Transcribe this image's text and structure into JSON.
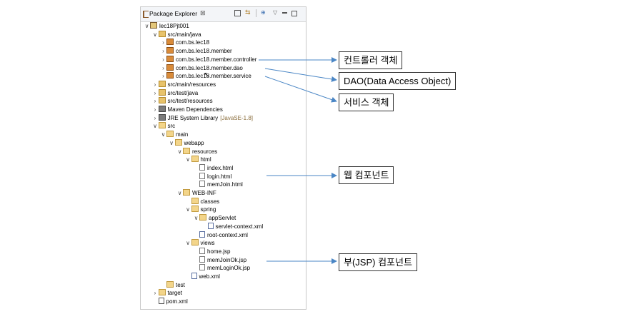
{
  "panel": {
    "title": "Package Explorer",
    "close_glyph": "⊠",
    "toolbar": {
      "link_glyph": "⇆",
      "focus_glyph": "⊕",
      "menu_glyph": "▽"
    }
  },
  "tree": [
    {
      "indent": 0,
      "chevron": "∨",
      "icon": "project",
      "label": "lec18Pjt001",
      "deco": ""
    },
    {
      "indent": 1,
      "chevron": "∨",
      "icon": "srcfolder",
      "label": "src/main/java",
      "deco": ""
    },
    {
      "indent": 2,
      "chevron": "›",
      "icon": "package",
      "label": "com.bs.lec18",
      "deco": ""
    },
    {
      "indent": 2,
      "chevron": "›",
      "icon": "package",
      "label": "com.bs.lec18.member",
      "deco": ""
    },
    {
      "indent": 2,
      "chevron": "›",
      "icon": "package",
      "label": "com.bs.lec18.member.controller",
      "deco": ""
    },
    {
      "indent": 2,
      "chevron": "›",
      "icon": "package",
      "label": "com.bs.lec18.member.dao",
      "deco": ""
    },
    {
      "indent": 2,
      "chevron": "›",
      "icon": "package",
      "label": "com.bs.lec18.member.service",
      "deco": ""
    },
    {
      "indent": 1,
      "chevron": "›",
      "icon": "srcfolder",
      "label": "src/main/resources",
      "deco": ""
    },
    {
      "indent": 1,
      "chevron": "›",
      "icon": "srcfolder",
      "label": "src/test/java",
      "deco": ""
    },
    {
      "indent": 1,
      "chevron": "›",
      "icon": "srcfolder",
      "label": "src/test/resources",
      "deco": ""
    },
    {
      "indent": 1,
      "chevron": "›",
      "icon": "library",
      "label": "Maven Dependencies",
      "deco": ""
    },
    {
      "indent": 1,
      "chevron": "›",
      "icon": "library",
      "label": "JRE System Library",
      "deco": "[JavaSE-1.8]"
    },
    {
      "indent": 1,
      "chevron": "∨",
      "icon": "folder",
      "label": "src",
      "deco": ""
    },
    {
      "indent": 2,
      "chevron": "∨",
      "icon": "folder",
      "label": "main",
      "deco": ""
    },
    {
      "indent": 3,
      "chevron": "∨",
      "icon": "folder",
      "label": "webapp",
      "deco": ""
    },
    {
      "indent": 4,
      "chevron": "∨",
      "icon": "folder",
      "label": "resources",
      "deco": ""
    },
    {
      "indent": 5,
      "chevron": "∨",
      "icon": "folder",
      "label": "html",
      "deco": ""
    },
    {
      "indent": 6,
      "chevron": "",
      "icon": "file",
      "label": "index.html",
      "deco": ""
    },
    {
      "indent": 6,
      "chevron": "",
      "icon": "file",
      "label": "login.html",
      "deco": ""
    },
    {
      "indent": 6,
      "chevron": "",
      "icon": "file",
      "label": "memJoin.html",
      "deco": ""
    },
    {
      "indent": 4,
      "chevron": "∨",
      "icon": "folder",
      "label": "WEB-INF",
      "deco": ""
    },
    {
      "indent": 5,
      "chevron": "",
      "icon": "folder",
      "label": "classes",
      "deco": ""
    },
    {
      "indent": 5,
      "chevron": "∨",
      "icon": "folder",
      "label": "spring",
      "deco": ""
    },
    {
      "indent": 6,
      "chevron": "∨",
      "icon": "folder",
      "label": "appServlet",
      "deco": ""
    },
    {
      "indent": 7,
      "chevron": "",
      "icon": "xml",
      "label": "servlet-context.xml",
      "deco": ""
    },
    {
      "indent": 6,
      "chevron": "",
      "icon": "xml",
      "label": "root-context.xml",
      "deco": ""
    },
    {
      "indent": 5,
      "chevron": "∨",
      "icon": "folder",
      "label": "views",
      "deco": ""
    },
    {
      "indent": 6,
      "chevron": "",
      "icon": "jsp",
      "label": "home.jsp",
      "deco": ""
    },
    {
      "indent": 6,
      "chevron": "",
      "icon": "jsp",
      "label": "memJoinOk.jsp",
      "deco": ""
    },
    {
      "indent": 6,
      "chevron": "",
      "icon": "jsp",
      "label": "memLoginOk.jsp",
      "deco": ""
    },
    {
      "indent": 5,
      "chevron": "",
      "icon": "xml",
      "label": "web.xml",
      "deco": ""
    },
    {
      "indent": 2,
      "chevron": "",
      "icon": "folder",
      "label": "test",
      "deco": ""
    },
    {
      "indent": 1,
      "chevron": "›",
      "icon": "folder",
      "label": "target",
      "deco": ""
    },
    {
      "indent": 1,
      "chevron": "",
      "icon": "pom",
      "label": "pom.xml",
      "deco": ""
    }
  ],
  "callouts": [
    {
      "key": "controller",
      "label": "컨트롤러 객체"
    },
    {
      "key": "dao",
      "label": "DAO(Data Access Object)"
    },
    {
      "key": "service",
      "label": "서비스 객체"
    },
    {
      "key": "web",
      "label": "웹 컴포넌트"
    },
    {
      "key": "jsp",
      "label": "부(JSP) 컴포넌트"
    }
  ],
  "colors": {
    "arrow": "#4a86c5",
    "accent_folder": "#e8c36b"
  }
}
